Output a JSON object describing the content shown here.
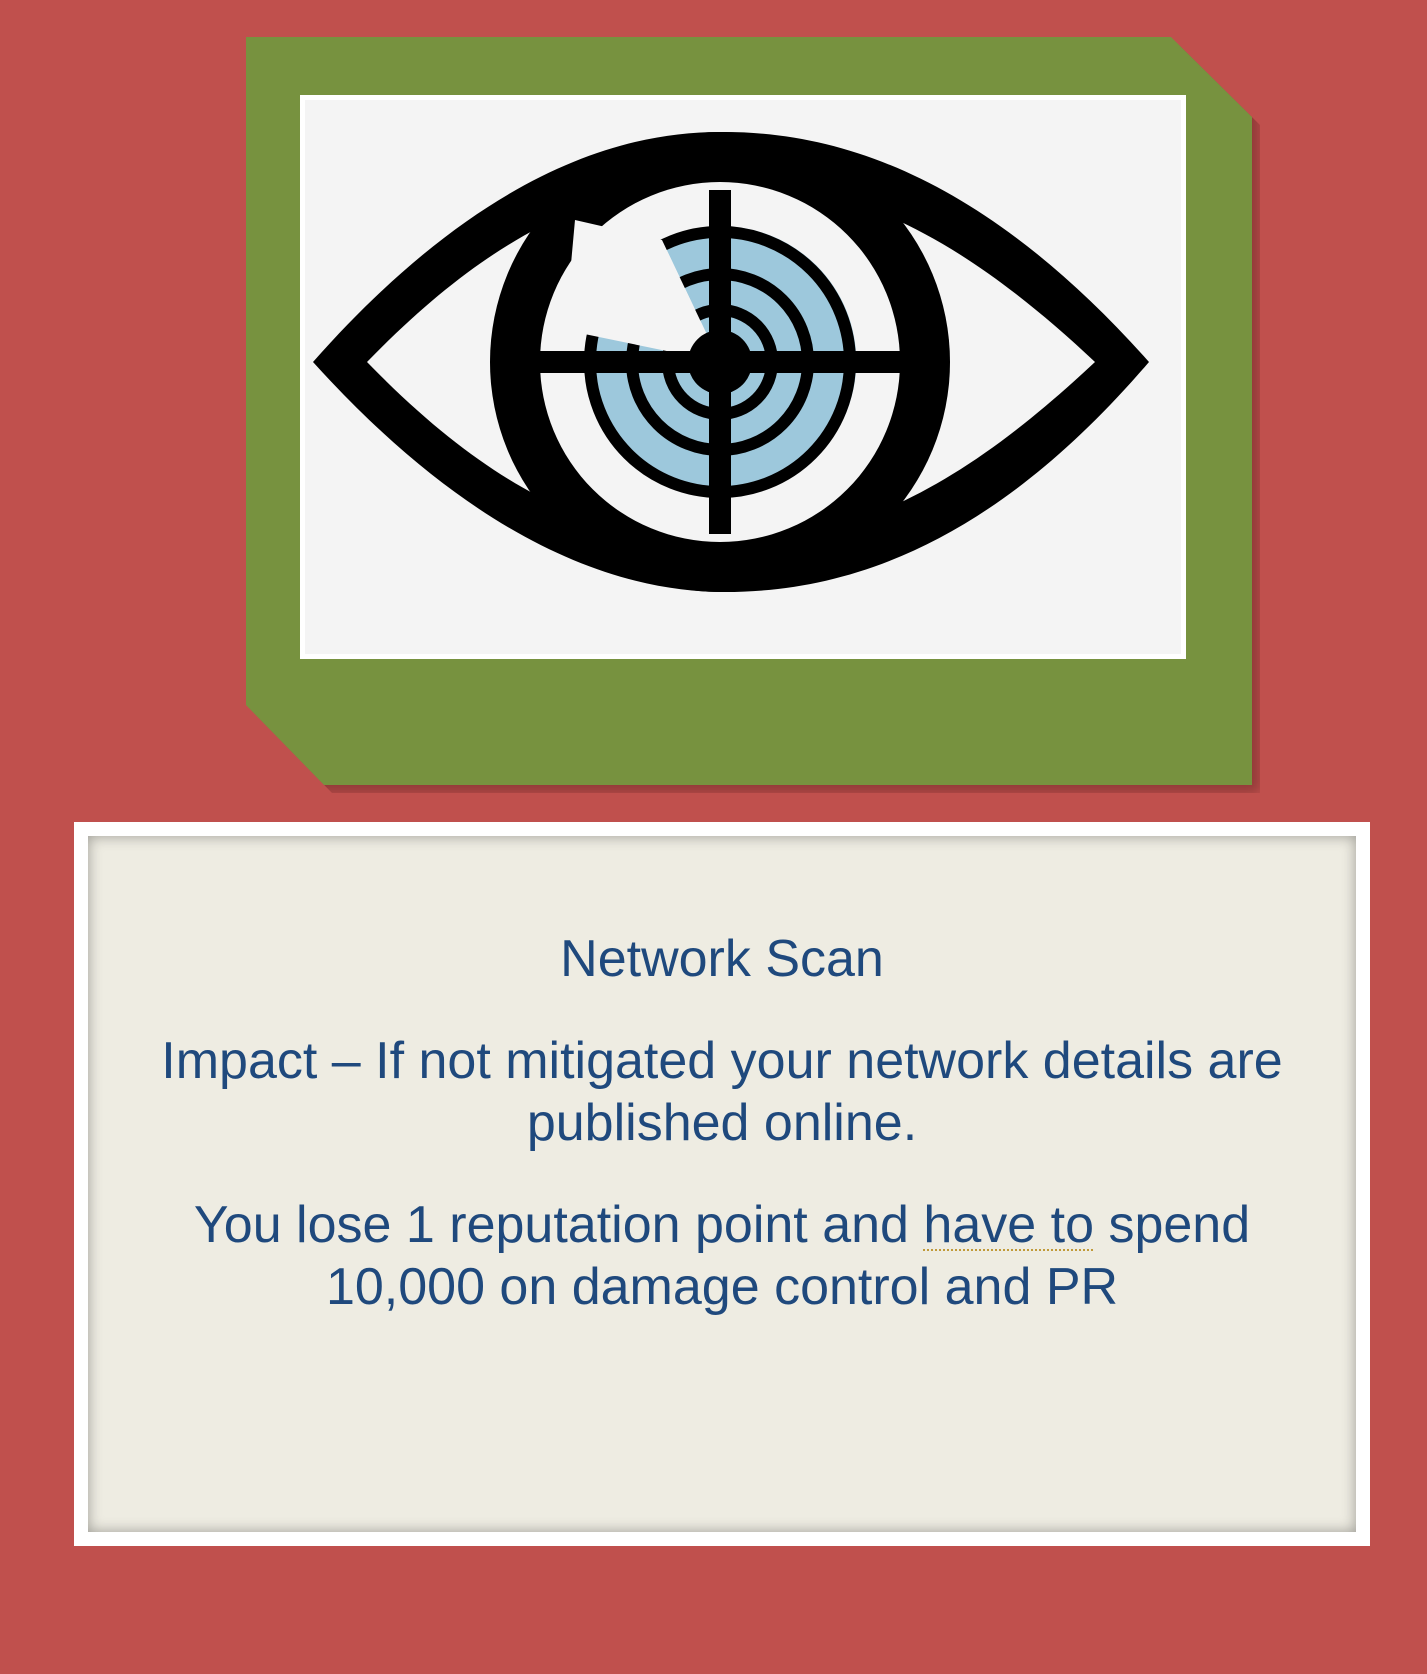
{
  "colors": {
    "background": "#c0504d",
    "frame": "#77923f",
    "card_fill": "#eeece2",
    "text": "#1f497d",
    "iris": "#9dc8dc",
    "eye_ink": "#000000",
    "dotted_underline": "#c09a3a"
  },
  "image": {
    "icon": "eye-crosshair-icon"
  },
  "card": {
    "title": "Network Scan",
    "impact": "Impact – If not mitigated your network details are published online.",
    "consequence": {
      "before": "You lose 1 reputation point and ",
      "underlined": "have to",
      "after": " spend 10,000 on damage control and PR"
    }
  }
}
